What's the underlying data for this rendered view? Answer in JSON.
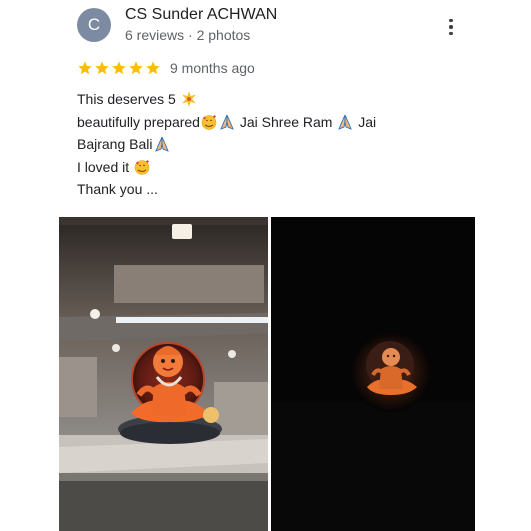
{
  "review": {
    "avatar_initial": "C",
    "reviewer_name": "CS Sunder ACHWAN",
    "reviewer_meta": "6 reviews · 2 photos",
    "rating": 5,
    "rating_max": 5,
    "time_ago": "9 months ago",
    "text": {
      "line1": "This deserves 5",
      "line2_a": "beautifully prepared",
      "line2_b": " Jai Shree Ram ",
      "line2_c": " Jai",
      "line3_a": "Bajrang Bali",
      "line4_a": "I loved it ",
      "line5": "Thank you ..."
    },
    "icons": [
      "avatar",
      "more-options-icon",
      "star-icon",
      "sparkle-emoji-icon",
      "smiling-hearts-emoji-icon",
      "folded-hands-emoji-icon"
    ],
    "photos": [
      {
        "name": "statue-indoor-photo"
      },
      {
        "name": "statue-dark-photo"
      }
    ],
    "colors": {
      "star": "#fbbc04",
      "meta": "#5f6368",
      "avatar": "#7c8ba1",
      "accent_orange": "#f26b2a"
    }
  }
}
